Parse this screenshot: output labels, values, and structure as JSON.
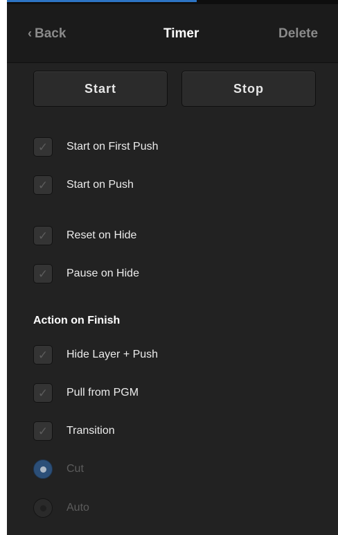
{
  "header": {
    "back_label": "Back",
    "back_icon": "chevron-left-icon",
    "title": "Timer",
    "delete_label": "Delete"
  },
  "controls": {
    "start_label": "Start",
    "stop_label": "Stop"
  },
  "options": [
    {
      "label": "Start on First Push",
      "checked": true
    },
    {
      "label": "Start on Push",
      "checked": true
    },
    {
      "label": "Reset on Hide",
      "checked": true
    },
    {
      "label": "Pause on Hide",
      "checked": true
    }
  ],
  "finish": {
    "heading": "Action on Finish",
    "options": [
      {
        "label": "Hide Layer + Push",
        "checked": true
      },
      {
        "label": "Pull from PGM",
        "checked": true
      },
      {
        "label": "Transition",
        "checked": true
      }
    ],
    "transition_modes": [
      {
        "label": "Cut",
        "selected": true,
        "disabled": true
      },
      {
        "label": "Auto",
        "selected": false,
        "disabled": true
      }
    ]
  },
  "colors": {
    "panel_bg": "#222222",
    "header_bg": "#1b1b1b",
    "accent": "#2d74c4",
    "text": "#ececec",
    "muted": "#8a8a8a"
  }
}
